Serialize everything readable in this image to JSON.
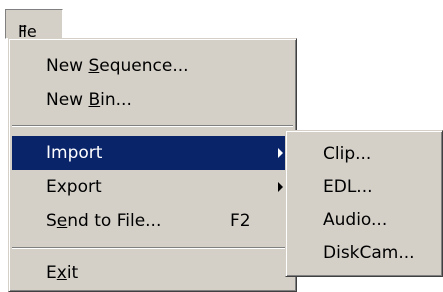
{
  "menubar": {
    "file": {
      "pre": "",
      "mnemonic": "F",
      "post": "ile"
    }
  },
  "file_menu": {
    "items": [
      {
        "pre": "New ",
        "mnemonic": "S",
        "post": "equence...",
        "shortcut": ""
      },
      {
        "pre": "New ",
        "mnemonic": "B",
        "post": "in...",
        "shortcut": ""
      },
      {
        "pre": "Import",
        "mnemonic": "",
        "post": "",
        "shortcut": ""
      },
      {
        "pre": "Export",
        "mnemonic": "",
        "post": "",
        "shortcut": ""
      },
      {
        "pre": "S",
        "mnemonic": "e",
        "post": "nd to File...",
        "shortcut": "F2"
      },
      {
        "pre": "E",
        "mnemonic": "x",
        "post": "it",
        "shortcut": ""
      }
    ]
  },
  "import_submenu": {
    "items": [
      {
        "label": "Clip..."
      },
      {
        "label": "EDL..."
      },
      {
        "label": "Audio..."
      },
      {
        "label": "DiskCam..."
      }
    ]
  },
  "colors": {
    "menu_bg": "#d4d0c8",
    "highlight_bg": "#0a246a",
    "highlight_text": "#ffffff"
  },
  "icons": [
    "submenu-arrow-icon"
  ]
}
